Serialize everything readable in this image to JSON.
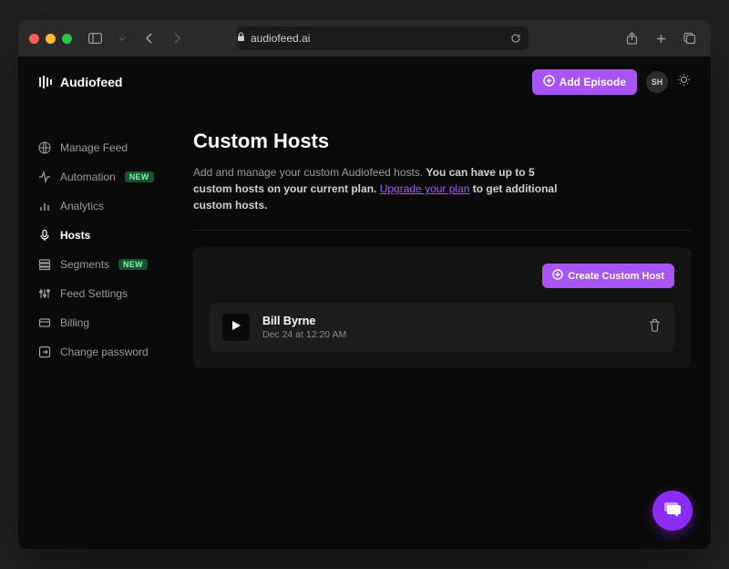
{
  "browser": {
    "url": "audiofeed.ai"
  },
  "brand": "Audiofeed",
  "topbar": {
    "add_episode_label": "Add Episode",
    "avatar_initials": "SH"
  },
  "sidebar": {
    "items": [
      {
        "label": "Manage Feed",
        "icon": "globe",
        "active": false,
        "badge": null
      },
      {
        "label": "Automation",
        "icon": "activity",
        "active": false,
        "badge": "NEW"
      },
      {
        "label": "Analytics",
        "icon": "bars",
        "active": false,
        "badge": null
      },
      {
        "label": "Hosts",
        "icon": "mic",
        "active": true,
        "badge": null
      },
      {
        "label": "Segments",
        "icon": "segments",
        "active": false,
        "badge": "NEW"
      },
      {
        "label": "Feed Settings",
        "icon": "sliders",
        "active": false,
        "badge": null
      },
      {
        "label": "Billing",
        "icon": "card",
        "active": false,
        "badge": null
      },
      {
        "label": "Change password",
        "icon": "logout",
        "active": false,
        "badge": null
      }
    ]
  },
  "page": {
    "title": "Custom Hosts",
    "desc_prefix": "Add and manage your custom Audiofeed hosts. ",
    "desc_bold": "You can have up to 5 custom hosts on your current plan. ",
    "desc_link": "Upgrade your plan",
    "desc_suffix": " to get additional custom hosts."
  },
  "panel": {
    "create_label": "Create Custom Host",
    "hosts": [
      {
        "name": "Bill Byrne",
        "date": "Dec 24 at 12:20 AM"
      }
    ]
  }
}
